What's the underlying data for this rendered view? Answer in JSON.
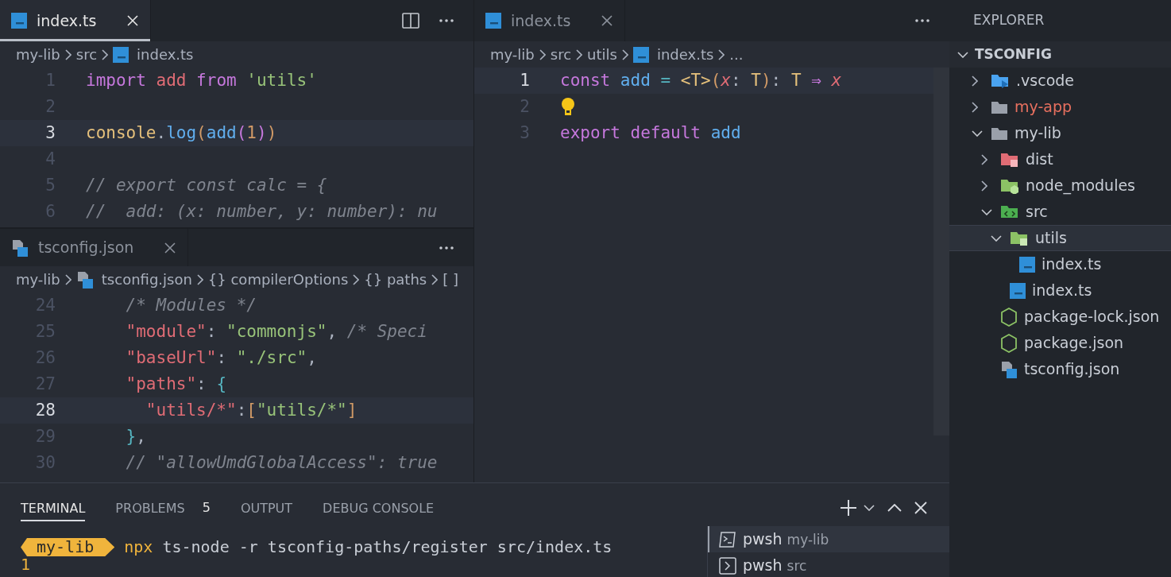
{
  "editors": [
    {
      "tabs": [
        {
          "label": "index.ts",
          "kind": "ts",
          "selected": true
        }
      ],
      "breadcrumb": [
        {
          "label": "my-lib"
        },
        {
          "label": "src"
        },
        {
          "label": "index.ts",
          "kind": "ts"
        }
      ],
      "lines": [
        {
          "number": "1",
          "current": false,
          "tokens": [
            {
              "text": "import ",
              "kind": "keyword"
            },
            {
              "text": "add ",
              "kind": "variable"
            },
            {
              "text": "from ",
              "kind": "keyword"
            },
            {
              "text": "'utils'",
              "kind": "string"
            }
          ]
        },
        {
          "number": "2",
          "current": false
        },
        {
          "number": "3",
          "current": true,
          "tokens": [
            {
              "text": "console",
              "kind": "object"
            },
            {
              "text": ".",
              "kind": "punct"
            },
            {
              "text": "log",
              "kind": "function"
            },
            {
              "text": "(",
              "kind": "bracket-gold"
            },
            {
              "text": "add",
              "kind": "function"
            },
            {
              "text": "(",
              "kind": "bracket-purple"
            },
            {
              "text": "1",
              "kind": "number"
            },
            {
              "text": ")",
              "kind": "bracket-purple"
            },
            {
              "text": ")",
              "kind": "bracket-gold"
            }
          ]
        },
        {
          "number": "4",
          "current": false
        },
        {
          "number": "5",
          "current": false,
          "tokens": [
            {
              "text": "// export const calc = {",
              "kind": "comment"
            }
          ]
        },
        {
          "number": "6",
          "current": false,
          "tokens": [
            {
              "text": "//  add: (x: number, y: number): nu",
              "kind": "comment"
            }
          ]
        }
      ]
    },
    {
      "tabs": [
        {
          "label": "tsconfig.json",
          "kind": "tsconfig",
          "selected": false
        }
      ],
      "breadcrumb": [
        {
          "label": "my-lib"
        },
        {
          "label": "tsconfig.json",
          "kind": "tsconfig"
        },
        {
          "label": "{} compilerOptions"
        },
        {
          "label": "{} paths"
        },
        {
          "label": "[ ]"
        }
      ],
      "lines": [
        {
          "number": "24",
          "current": false,
          "tokens": [
            {
              "text": "    /* Modules */",
              "kind": "comment"
            }
          ]
        },
        {
          "number": "25",
          "current": false,
          "tokens": [
            {
              "text": "    \"module\"",
              "kind": "variable"
            },
            {
              "text": ": ",
              "kind": "punct"
            },
            {
              "text": "\"commonjs\"",
              "kind": "string"
            },
            {
              "text": ", ",
              "kind": "punct"
            },
            {
              "text": "/* Speci",
              "kind": "comment"
            }
          ]
        },
        {
          "number": "26",
          "current": false,
          "tokens": [
            {
              "text": "    \"baseUrl\"",
              "kind": "variable"
            },
            {
              "text": ": ",
              "kind": "punct"
            },
            {
              "text": "\"./src\"",
              "kind": "string"
            },
            {
              "text": ",",
              "kind": "punct"
            }
          ]
        },
        {
          "number": "27",
          "current": false,
          "tokens": [
            {
              "text": "    \"paths\"",
              "kind": "variable"
            },
            {
              "text": ": ",
              "kind": "punct"
            },
            {
              "text": "{",
              "kind": "bracket-blue"
            }
          ]
        },
        {
          "number": "28",
          "current": true,
          "tokens": [
            {
              "text": "      \"utils/*\"",
              "kind": "variable"
            },
            {
              "text": ":",
              "kind": "punct"
            },
            {
              "text": "[",
              "kind": "bracket-gold"
            },
            {
              "text": "\"utils/*\"",
              "kind": "string"
            },
            {
              "text": "]",
              "kind": "bracket-gold"
            }
          ]
        },
        {
          "number": "29",
          "current": false,
          "tokens": [
            {
              "text": "    }",
              "kind": "bracket-blue"
            },
            {
              "text": ",",
              "kind": "punct"
            }
          ]
        },
        {
          "number": "30",
          "current": false,
          "tokens": [
            {
              "text": "    // \"allowUmdGlobalAccess\": true",
              "kind": "comment"
            }
          ]
        }
      ]
    },
    {
      "tabs": [
        {
          "label": "index.ts",
          "kind": "ts",
          "selected": false
        }
      ],
      "breadcrumb": [
        {
          "label": "my-lib"
        },
        {
          "label": "src"
        },
        {
          "label": "utils"
        },
        {
          "label": "index.ts",
          "kind": "ts"
        },
        {
          "label": "..."
        }
      ],
      "lines": [
        {
          "number": "1",
          "current": true,
          "tokens": [
            {
              "text": "const ",
              "kind": "keyword"
            },
            {
              "text": "add ",
              "kind": "function"
            },
            {
              "text": "= ",
              "kind": "operator"
            },
            {
              "text": "<T>",
              "kind": "type"
            },
            {
              "text": "(",
              "kind": "bracket-gold"
            },
            {
              "text": "x",
              "kind": "param"
            },
            {
              "text": ": ",
              "kind": "punct"
            },
            {
              "text": "T",
              "kind": "type"
            },
            {
              "text": ")",
              "kind": "bracket-gold"
            },
            {
              "text": ": ",
              "kind": "punct"
            },
            {
              "text": "T ",
              "kind": "type"
            },
            {
              "text": "⇒ ",
              "kind": "keyword"
            },
            {
              "text": "x",
              "kind": "param"
            }
          ]
        },
        {
          "number": "2",
          "current": false,
          "lightbulb": true
        },
        {
          "number": "3",
          "current": false,
          "tokens": [
            {
              "text": "export ",
              "kind": "keyword"
            },
            {
              "text": "default ",
              "kind": "keyword"
            },
            {
              "text": "add",
              "kind": "function"
            }
          ]
        }
      ]
    }
  ],
  "panel": {
    "tabs": [
      {
        "label": "TERMINAL",
        "selected": true
      },
      {
        "label": "PROBLEMS",
        "selected": false,
        "count": "5"
      },
      {
        "label": "OUTPUT",
        "selected": false
      },
      {
        "label": "DEBUG CONSOLE",
        "selected": false
      }
    ],
    "terminal": {
      "prompt": "my-lib",
      "command": "npx",
      "args": "ts-node -r tsconfig-paths/register src/index.ts",
      "output": "1"
    },
    "terminals": [
      {
        "shell": "pwsh",
        "folder": "my-lib",
        "selected": true
      },
      {
        "shell": "pwsh",
        "folder": "src",
        "selected": false
      }
    ]
  },
  "explorer": {
    "title": "EXPLORER",
    "section": "TSCONFIG",
    "items": [
      {
        "label": ".vscode",
        "kind": "vscode-folder",
        "expanded": false,
        "selected": false
      },
      {
        "label": "my-app",
        "kind": "folder",
        "expanded": false,
        "selected": false,
        "color": "#e8705f"
      },
      {
        "label": "my-lib",
        "kind": "folder",
        "expanded": true,
        "selected": false,
        "children": [
          {
            "label": "dist",
            "kind": "dist-folder",
            "expanded": false,
            "selected": false
          },
          {
            "label": "node_modules",
            "kind": "node-folder",
            "expanded": false,
            "selected": false
          },
          {
            "label": "src",
            "kind": "src-folder",
            "expanded": true,
            "selected": false,
            "children": [
              {
                "label": "utils",
                "kind": "utils-folder",
                "expanded": true,
                "selected": true,
                "children": [
                  {
                    "label": "index.ts",
                    "kind": "ts",
                    "selected": false
                  }
                ]
              },
              {
                "label": "index.ts",
                "kind": "ts",
                "selected": false
              }
            ]
          },
          {
            "label": "package-lock.json",
            "kind": "js",
            "selected": false
          },
          {
            "label": "package.json",
            "kind": "js",
            "selected": false
          },
          {
            "label": "tsconfig.json",
            "kind": "tsconfig",
            "selected": false
          }
        ]
      }
    ]
  }
}
